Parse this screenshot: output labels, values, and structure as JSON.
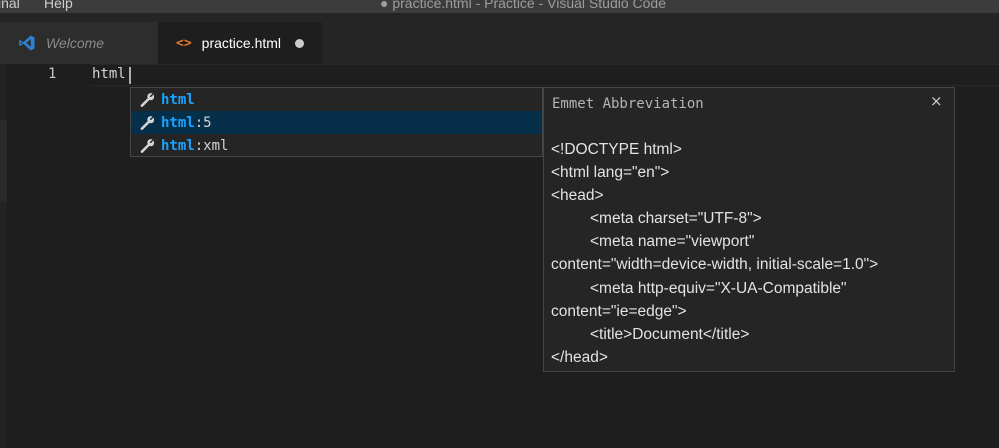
{
  "menubar": {
    "items": [
      {
        "label": "inal"
      },
      {
        "label": "Help"
      }
    ],
    "window_title": "● practice.html - Practice - Visual Studio Code"
  },
  "tabs": [
    {
      "label": "Welcome",
      "icon": "vscode-icon",
      "active": false
    },
    {
      "label": "practice.html",
      "icon": "html-file-icon",
      "active": true,
      "dirty": true,
      "icon_glyph": "<>"
    }
  ],
  "editor": {
    "lines": [
      {
        "number": "1",
        "text": "html"
      }
    ]
  },
  "suggest": {
    "items": [
      {
        "match": "html",
        "rest": "",
        "selected": false,
        "icon": "wrench-icon"
      },
      {
        "match": "html",
        "rest": ":5",
        "selected": true,
        "icon": "wrench-icon"
      },
      {
        "match": "html",
        "rest": ":xml",
        "selected": false,
        "icon": "wrench-icon"
      }
    ]
  },
  "details": {
    "title": "Emmet Abbreviation",
    "close_symbol": "×",
    "lines": [
      {
        "text": "<!DOCTYPE html>",
        "indent": false
      },
      {
        "text": "<html lang=\"en\">",
        "indent": false
      },
      {
        "text": "<head>",
        "indent": false
      },
      {
        "text": "<meta charset=\"UTF-8\">",
        "indent": true
      },
      {
        "text": "<meta name=\"viewport\"",
        "indent": true
      },
      {
        "text": "content=\"width=device-width, initial-scale=1.0\">",
        "indent": false
      },
      {
        "text": "<meta http-equiv=\"X-UA-Compatible\"",
        "indent": true
      },
      {
        "text": "content=\"ie=edge\">",
        "indent": false
      },
      {
        "text": "<title>Document</title>",
        "indent": true
      },
      {
        "text": "</head>",
        "indent": false
      }
    ]
  },
  "colors": {
    "editor_bg": "#1e1e1e",
    "selected_suggestion_bg": "#062f4a",
    "match_highlight": "#18a3ff",
    "html_icon": "#e37933",
    "vscode_blue": "#2f80d1"
  }
}
